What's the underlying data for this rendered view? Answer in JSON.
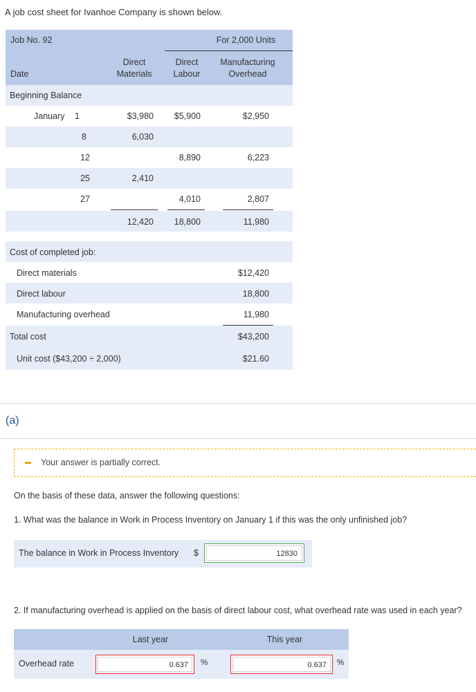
{
  "intro": "A job cost sheet for Ivanhoe Company is shown below.",
  "job_sheet": {
    "job_no": "Job No. 92",
    "units": "For 2,000 Units",
    "col_date": "Date",
    "col_dm": [
      "Direct",
      "Materials"
    ],
    "col_dl": [
      "Direct",
      "Labour"
    ],
    "col_moh": [
      "Manufacturing",
      "Overhead"
    ],
    "beginning_balance": "Beginning Balance",
    "rows": [
      {
        "month": "January",
        "day": "1",
        "dm": "$3,980",
        "dl": "$5,900",
        "moh": "$2,950"
      },
      {
        "month": "",
        "day": "8",
        "dm": "6,030",
        "dl": "",
        "moh": ""
      },
      {
        "month": "",
        "day": "12",
        "dm": "",
        "dl": "8,890",
        "moh": "6,223"
      },
      {
        "month": "",
        "day": "25",
        "dm": "2,410",
        "dl": "",
        "moh": ""
      },
      {
        "month": "",
        "day": "27",
        "dm": "",
        "dl": "4,010",
        "moh": "2,807"
      }
    ],
    "totals": {
      "dm": "12,420",
      "dl": "18,800",
      "moh": "11,980"
    },
    "cost_completed_label": "Cost of completed job:",
    "completed": [
      {
        "label": "Direct materials",
        "value": "$12,420"
      },
      {
        "label": "Direct labour",
        "value": "18,800"
      },
      {
        "label": "Manufacturing overhead",
        "value": "11,980"
      }
    ],
    "total_cost_label": "Total cost",
    "total_cost": "$43,200",
    "unit_cost_label": "Unit cost ($43,200 ÷ 2,000)",
    "unit_cost": "$21.60"
  },
  "part_label": "(a)",
  "feedback": "Your answer is partially correct.",
  "prompt": "On the basis of these data, answer the following questions:",
  "q1": "1. What was the balance in Work in Process Inventory on January 1 if this was the only unfinished job?",
  "q1_label": "The balance in Work in Process Inventory",
  "currency": "$",
  "q1_value": "12830",
  "q2": "2. If manufacturing overhead is applied on the basis of direct labour cost, what overhead rate was used in each year?",
  "q2_cols": [
    "Last year",
    "This year"
  ],
  "q2_row_label": "Overhead rate",
  "q2_last": "0.637",
  "q2_this": "0.637",
  "percent": "%",
  "colors": {
    "header": "#b9cbe8",
    "band": "#e5ecf8",
    "correct": "#4caf50",
    "incorrect": "#e02b2b",
    "partial": "#f0b400"
  }
}
